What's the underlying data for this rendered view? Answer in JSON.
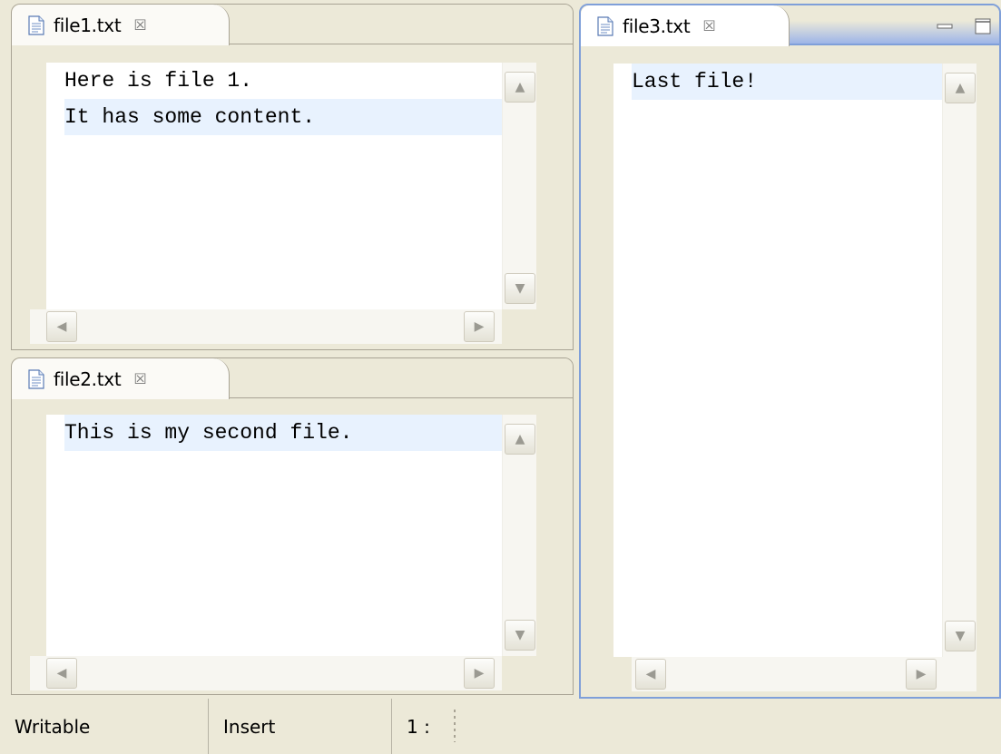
{
  "panes": {
    "file1": {
      "tab_label": "file1.txt",
      "lines": [
        "Here is file 1.",
        "It has some content."
      ]
    },
    "file2": {
      "tab_label": "file2.txt",
      "lines": [
        "This is my second file."
      ]
    },
    "file3": {
      "tab_label": "file3.txt",
      "lines": [
        "Last file!"
      ]
    }
  },
  "status_bar": {
    "mode": "Writable",
    "insert_mode": "Insert",
    "position": "1 :"
  },
  "icons": {
    "file": "text-file-icon",
    "close": "close-icon",
    "minimize": "minimize-icon",
    "maximize": "maximize-icon",
    "scroll_up": "chevron-up-icon",
    "scroll_down": "chevron-down-icon",
    "scroll_left": "chevron-left-icon",
    "scroll_right": "chevron-right-icon"
  },
  "colors": {
    "background": "#ece9d8",
    "active_border": "#7f9fd9",
    "current_line": "#e8f2fe"
  }
}
